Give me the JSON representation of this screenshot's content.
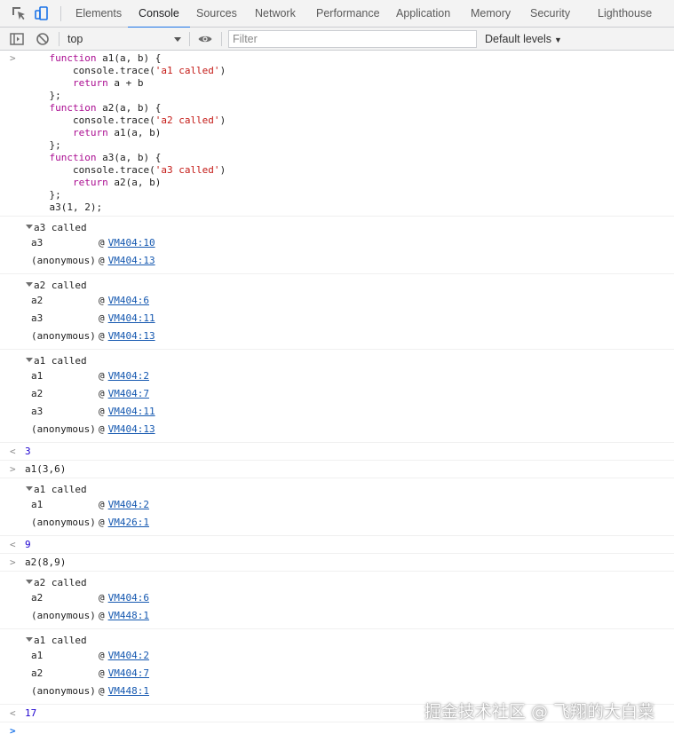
{
  "tabs": [
    {
      "label": "Elements",
      "active": false
    },
    {
      "label": "Console",
      "active": true
    },
    {
      "label": "Sources",
      "active": false
    },
    {
      "label": "Network",
      "active": false
    },
    {
      "label": "Performance",
      "active": false
    },
    {
      "label": "Application",
      "active": false
    },
    {
      "label": "Memory",
      "active": false
    },
    {
      "label": "Security",
      "active": false
    },
    {
      "label": "Lighthouse",
      "active": false
    }
  ],
  "toolbar": {
    "context": "top",
    "filter_placeholder": "Filter",
    "levels_label": "Default levels"
  },
  "console": {
    "input_prompt": ">",
    "result_prompt": "<",
    "code_lines": [
      "    function a1(a, b) {",
      "        console.trace('a1 called')",
      "        return a + b",
      "    };",
      "    function a2(a, b) {",
      "        console.trace('a2 called')",
      "        return a1(a, b)",
      "    };",
      "    function a3(a, b) {",
      "        console.trace('a3 called')",
      "        return a2(a, b)",
      "    };",
      "    a3(1, 2);"
    ],
    "traces": [
      {
        "title": "a3 called",
        "frames": [
          {
            "fn": "a3",
            "at": "@",
            "link": "VM404:10"
          },
          {
            "fn": "(anonymous)",
            "at": "@",
            "link": "VM404:13"
          }
        ]
      },
      {
        "title": "a2 called",
        "frames": [
          {
            "fn": "a2",
            "at": "@",
            "link": "VM404:6"
          },
          {
            "fn": "a3",
            "at": "@",
            "link": "VM404:11"
          },
          {
            "fn": "(anonymous)",
            "at": "@",
            "link": "VM404:13"
          }
        ]
      },
      {
        "title": "a1 called",
        "frames": [
          {
            "fn": "a1",
            "at": "@",
            "link": "VM404:2"
          },
          {
            "fn": "a2",
            "at": "@",
            "link": "VM404:7"
          },
          {
            "fn": "a3",
            "at": "@",
            "link": "VM404:11"
          },
          {
            "fn": "(anonymous)",
            "at": "@",
            "link": "VM404:13"
          }
        ]
      },
      {
        "title": "a1 called",
        "frames": [
          {
            "fn": "a1",
            "at": "@",
            "link": "VM404:2"
          },
          {
            "fn": "(anonymous)",
            "at": "@",
            "link": "VM426:1"
          }
        ]
      },
      {
        "title": "a2 called",
        "frames": [
          {
            "fn": "a2",
            "at": "@",
            "link": "VM404:6"
          },
          {
            "fn": "(anonymous)",
            "at": "@",
            "link": "VM448:1"
          }
        ]
      },
      {
        "title": "a1 called",
        "frames": [
          {
            "fn": "a1",
            "at": "@",
            "link": "VM404:2"
          },
          {
            "fn": "a2",
            "at": "@",
            "link": "VM404:7"
          },
          {
            "fn": "(anonymous)",
            "at": "@",
            "link": "VM448:1"
          }
        ]
      }
    ],
    "results": [
      "3",
      "9",
      "17"
    ],
    "commands": [
      "a1(3,6)",
      "a2(8,9)"
    ]
  },
  "watermark": "掘金技术社区 @ 飞翔的大白菜",
  "colors": {
    "accent": "#1a73e8",
    "link": "#1558b0",
    "keyword": "#aa0d91",
    "string": "#c41a16",
    "number": "#1c00cf"
  },
  "icons": {
    "inspect": "inspect-element-icon",
    "device": "device-toolbar-icon",
    "sidebar": "show-sidebar-icon",
    "clear": "clear-console-icon",
    "eye": "live-expression-icon"
  }
}
